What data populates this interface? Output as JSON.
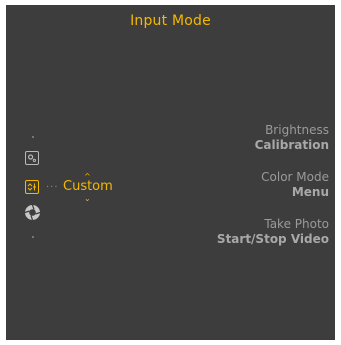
{
  "header": {
    "title": "Input Mode"
  },
  "mode_selector": {
    "current_value": "Custom",
    "icons": [
      "settings-icon",
      "input-mode-icon",
      "aperture-icon"
    ]
  },
  "hints": [
    {
      "label": "Brightness",
      "action": "Calibration"
    },
    {
      "label": "Color Mode",
      "action": "Menu"
    },
    {
      "label": "Take Photo",
      "action": "Start/Stop Video"
    }
  ],
  "colors": {
    "background": "#3d3d3d",
    "accent": "#f5b800",
    "muted_text": "#9a9a9a"
  }
}
